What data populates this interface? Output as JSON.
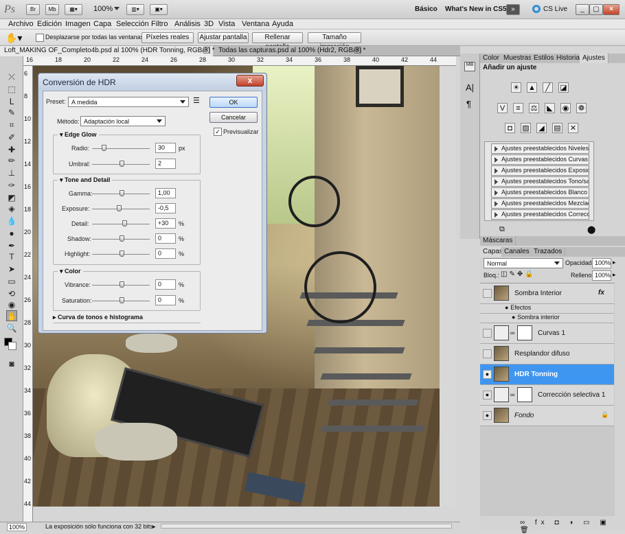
{
  "app": {
    "logo": "Ps",
    "zoom": "100%",
    "workspace": "Básico",
    "whats_new": "What's New in CS5",
    "cs_live": "CS Live",
    "bridge": "Br",
    "minibridge": "Mb"
  },
  "menu": [
    "Archivo",
    "Edición",
    "Imagen",
    "Capa",
    "Selección",
    "Filtro",
    "Análisis",
    "3D",
    "Vista",
    "Ventana",
    "Ayuda"
  ],
  "options": {
    "scroll_all": "Desplazarse por todas las ventanas",
    "actual_pixels": "Píxeles reales",
    "fit_screen": "Ajustar pantalla",
    "fill_screen": "Rellenar pantalla",
    "print_size": "Tamaño impresión"
  },
  "doc_tabs": [
    {
      "label": "Loft_MAKING OF_Completo4b.psd al 100% (HDR Tonning, RGB/8) *"
    },
    {
      "label": "Todas las capturas.psd al 100% (Hdr2, RGB/8) *"
    }
  ],
  "ruler_top": [
    "16",
    "18",
    "20",
    "22",
    "24",
    "26",
    "28",
    "30",
    "32",
    "34",
    "36",
    "38",
    "40",
    "42",
    "44"
  ],
  "ruler_left": [
    "6",
    "8",
    "10",
    "12",
    "14",
    "16",
    "18",
    "20",
    "22",
    "24",
    "26",
    "28",
    "30",
    "32",
    "34",
    "36",
    "38",
    "40",
    "42",
    "44"
  ],
  "status": {
    "zoom": "100%",
    "message": "La exposición sólo funciona con 32 bits"
  },
  "dialog": {
    "title": "Conversión de HDR",
    "close": "x",
    "preset_label": "Preset:",
    "preset_value": "A medida",
    "method_label": "Método:",
    "method_value": "Adaptación local",
    "ok": "OK",
    "cancel": "Cancelar",
    "preview": "Previsualizar",
    "edge_glow": {
      "title": "Edge Glow",
      "radio_label": "Radio:",
      "radio_value": "30",
      "radio_unit": "px",
      "umbral_label": "Umbral:",
      "umbral_value": "2"
    },
    "tone": {
      "title": "Tone and Detail",
      "gamma_label": "Gamma:",
      "gamma_value": "1,00",
      "exposure_label": "Exposure:",
      "exposure_value": "-0,5",
      "detail_label": "Detail:",
      "detail_value": "+30",
      "detail_unit": "%",
      "shadow_label": "Shadow:",
      "shadow_value": "0",
      "shadow_unit": "%",
      "highlight_label": "Highlight:",
      "highlight_value": "0",
      "highlight_unit": "%"
    },
    "color": {
      "title": "Color",
      "vibrance_label": "Vibrance:",
      "vibrance_value": "0",
      "vibrance_unit": "%",
      "saturation_label": "Saturation:",
      "saturation_value": "0",
      "saturation_unit": "%"
    },
    "curve": "Curva de tonos e histograma"
  },
  "panels": {
    "top_tabs": [
      "Color",
      "Muestras",
      "Estilos",
      "Historia",
      "Ajustes"
    ],
    "add_adjust": "Añadir un ajuste",
    "presets": [
      "Ajustes preestablecidos Niveles",
      "Ajustes preestablecidos Curvas",
      "Ajustes preestablecidos Exposición",
      "Ajustes preestablecidos Tono/sat...",
      "Ajustes preestablecidos Blanco y ...",
      "Ajustes preestablecidos Mezclado...",
      "Ajustes preestablecidos Correcci..."
    ],
    "masks_tab": "Máscaras",
    "layer_tabs": [
      "Capas",
      "Canales",
      "Trazados"
    ],
    "blend_mode": "Normal",
    "opacity_label": "Opacidad:",
    "opacity_value": "100%",
    "lock_label": "Bloq.:",
    "fill_label": "Relleno:",
    "fill_value": "100%",
    "layers": [
      {
        "name": "Sombra Interior",
        "fx": "fx"
      },
      {
        "name": "Efectos"
      },
      {
        "name": "Sombra interior"
      },
      {
        "name": "Curvas 1"
      },
      {
        "name": "Resplandor difuso"
      },
      {
        "name": "HDR Tonning"
      },
      {
        "name": "Corrección selectiva 1"
      },
      {
        "name": "Fondo"
      }
    ]
  },
  "colors": {
    "selected_layer": "#3f96f0",
    "dialog_frame": "#c8d3e3"
  }
}
